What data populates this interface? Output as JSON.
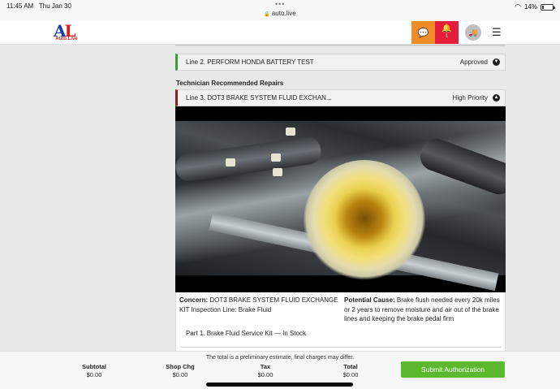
{
  "status_bar": {
    "time": "11:45 AM",
    "date": "Thu Jan 30",
    "url": "auto.live",
    "battery": "14%"
  },
  "header": {
    "logo_letters_a": "A",
    "logo_letters_l": "L",
    "logo_text": "Auto.Live",
    "notification_count": "1",
    "icons": [
      "chat-icon",
      "bell-icon",
      "car-icon",
      "menu-icon"
    ],
    "accent_orange": "#f28c28",
    "accent_red": "#e41e3a"
  },
  "lines": {
    "line2": {
      "label": "Line 2. PERFORM HONDA BATTERY TEST",
      "status": "Approved",
      "color": "#3a9c3a"
    },
    "section_title": "Technician Recommended Repairs",
    "line3": {
      "label": "Line 3. DOT3 BRAKE SYSTEM FLUID EXCHAN...",
      "status": "High Priority",
      "color": "#8b1e1e"
    }
  },
  "details": {
    "concern_label": "Concern:",
    "concern_text": "DOT3 BRAKE SYSTEM FLUID EXCHANGE KIT Inspection Line: Brake Fluid",
    "cause_label": "Potential Cause:",
    "cause_text": "Brake flush needed every 20k miles or 2 years to remove moisture and air out of the brake lines and keeping the brake pedal firm",
    "part": "Part 1. Brake Fluid Service Kit — In Stock"
  },
  "footer": {
    "note": "The total is a preliminary estimate, final charges may differ.",
    "subtotal_label": "Subtotal",
    "subtotal_value": "$0.00",
    "shop_label": "Shop Chg",
    "shop_value": "$0.00",
    "tax_label": "Tax",
    "tax_value": "$0.00",
    "total_label": "Total",
    "total_value": "$0.00",
    "submit_label": "Submit Authorization",
    "submit_color": "#5cb82f"
  }
}
